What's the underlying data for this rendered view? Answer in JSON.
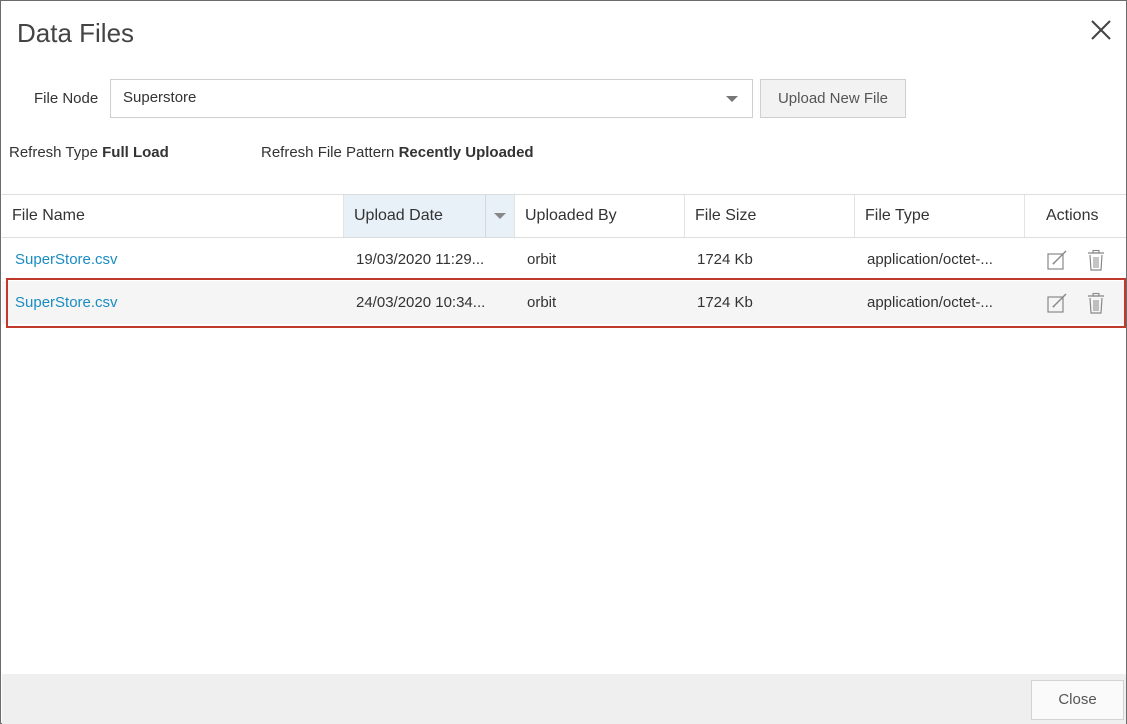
{
  "dialog": {
    "title": "Data Files",
    "close_icon": "close-icon"
  },
  "file_node": {
    "label": "File Node",
    "selected": "Superstore"
  },
  "upload_button": "Upload New File",
  "refresh": {
    "type_label": "Refresh Type",
    "type_value": "Full Load",
    "pattern_label": "Refresh File Pattern",
    "pattern_value": "Recently Uploaded"
  },
  "table": {
    "columns": [
      "File Name",
      "Upload Date",
      "Uploaded By",
      "File Size",
      "File Type",
      "Actions"
    ],
    "sorted_column": "Upload Date",
    "rows": [
      {
        "file_name": "SuperStore.csv",
        "upload_date": "19/03/2020 11:29...",
        "uploaded_by": "orbit",
        "file_size": "1724 Kb",
        "file_type": "application/octet-...",
        "actions": [
          "edit-icon",
          "trash-icon"
        ]
      },
      {
        "file_name": "SuperStore.csv",
        "upload_date": "24/03/2020 10:34...",
        "uploaded_by": "orbit",
        "file_size": "1724 Kb",
        "file_type": "application/octet-...",
        "actions": [
          "edit-icon",
          "trash-icon"
        ]
      }
    ],
    "highlighted_row": 1
  },
  "footer": {
    "close_button": "Close"
  },
  "colors": {
    "link": "#1a8cc2",
    "highlight_border": "#c0392b",
    "sorted_header_bg": "#e8f0f8"
  }
}
